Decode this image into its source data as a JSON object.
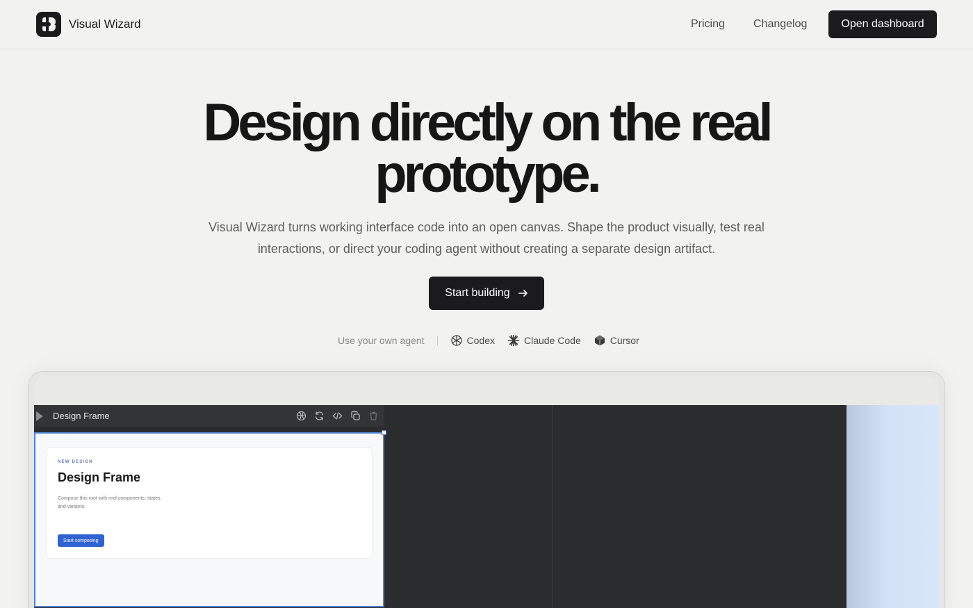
{
  "nav": {
    "brand": "Visual Wizard",
    "links": [
      "Pricing",
      "Changelog"
    ],
    "cta": "Open dashboard"
  },
  "hero": {
    "title": "Design directly on the real prototype.",
    "subtitle": "Visual Wizard turns working interface code into an open canvas. Shape the product visually, test real interactions, or direct your coding agent without creating a separate design artifact.",
    "cta": "Start building"
  },
  "agents": {
    "lead": "Use your own agent",
    "items": [
      {
        "label": "Codex",
        "icon": "openai-icon"
      },
      {
        "label": "Claude Code",
        "icon": "claude-burst-icon"
      },
      {
        "label": "Cursor",
        "icon": "cursor-cube-icon"
      }
    ]
  },
  "preview": {
    "frame_bar_title": "Design Frame",
    "tools": [
      "globe-icon",
      "refresh-icon",
      "code-icon",
      "copy-icon",
      "trash-icon"
    ],
    "card": {
      "eyebrow": "NEW DESIGN",
      "title": "Design Frame",
      "body": "Compose this root with real components, states, and variants.",
      "button": "Start composing"
    }
  },
  "colors": {
    "background": "#f2f2f1",
    "dark_button": "#1b1b1d",
    "canvas": "#2b2c2e",
    "selection": "#4f7fd0",
    "primary_blue": "#2f63d2"
  }
}
